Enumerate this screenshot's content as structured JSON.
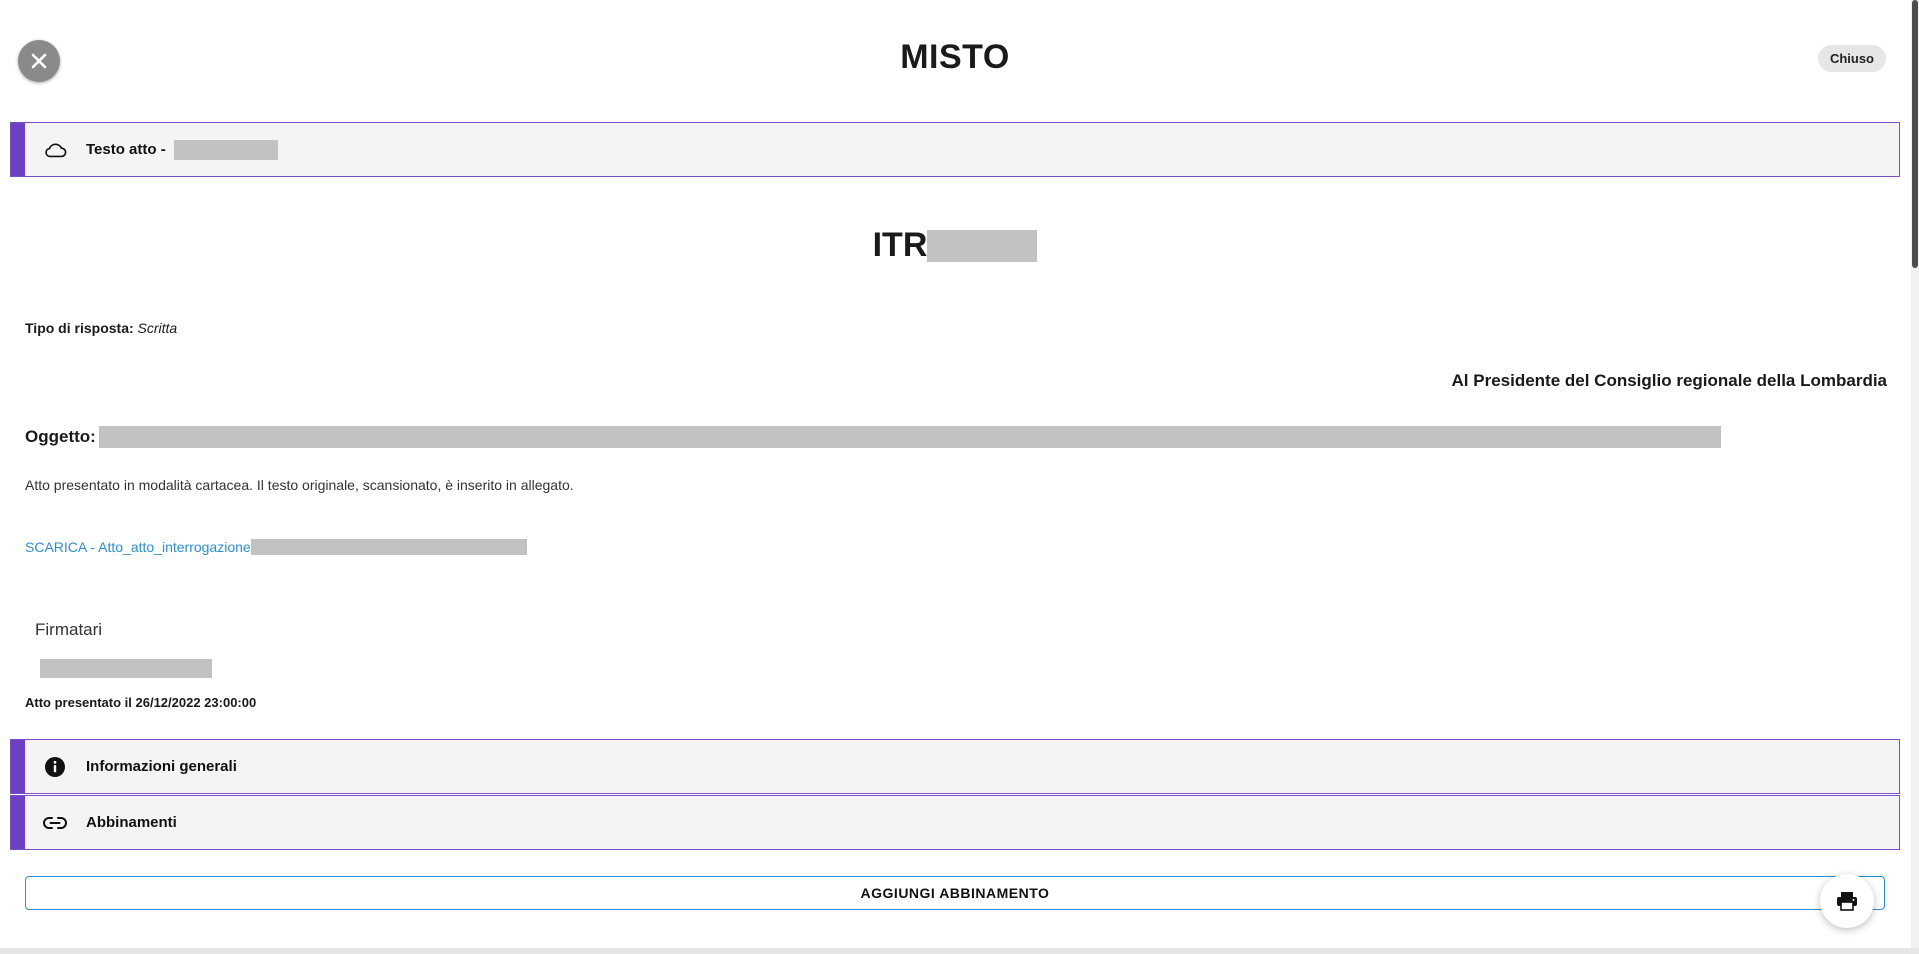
{
  "header": {
    "title": "MISTO",
    "status": "Chiuso",
    "close_icon": "close-icon"
  },
  "sections": {
    "testo_atto": {
      "label": "Testo atto -",
      "icon": "cloud-icon"
    },
    "informazioni_generali": {
      "label": "Informazioni generali",
      "icon": "info-icon"
    },
    "abbinamenti": {
      "label": "Abbinamenti",
      "icon": "link-icon"
    }
  },
  "document": {
    "act_prefix": "ITR",
    "tipo_label": "Tipo di risposta:",
    "tipo_value": "Scritta",
    "recipient": "Al Presidente del Consiglio regionale della Lombardia",
    "oggetto_label": "Oggetto:",
    "note": "Atto presentato in modalità cartacea. Il testo originale, scansionato, è inserito in allegato.",
    "download_link": "SCARICA - Atto_atto_interrogazione",
    "signers_title": "Firmatari",
    "presented": "Atto presentato il 26/12/2022 23:00:00"
  },
  "actions": {
    "add_pairing": "AGGIUNGI ABBINAMENTO",
    "print_icon": "print-icon"
  },
  "colors": {
    "accent_purple": "#6d3fc3",
    "link_blue": "#2b8fd6",
    "redaction_gray": "#c2c2c2"
  }
}
